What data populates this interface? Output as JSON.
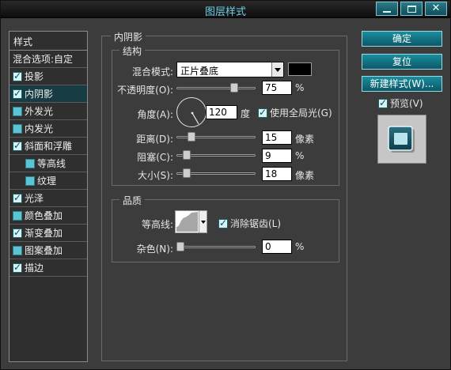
{
  "window": {
    "title": "图层样式"
  },
  "style_list": {
    "header": "样式",
    "items": [
      {
        "label": "混合选项:自定",
        "checkbox": "none"
      },
      {
        "label": "投影",
        "checkbox": "checked"
      },
      {
        "label": "内阴影",
        "checkbox": "checked",
        "active": true
      },
      {
        "label": "外发光",
        "checkbox": "unchecked"
      },
      {
        "label": "内发光",
        "checkbox": "unchecked"
      },
      {
        "label": "斜面和浮雕",
        "checkbox": "checked"
      },
      {
        "label": "等高线",
        "checkbox": "unchecked"
      },
      {
        "label": "纹理",
        "checkbox": "unchecked"
      },
      {
        "label": "光泽",
        "checkbox": "checked"
      },
      {
        "label": "颜色叠加",
        "checkbox": "unchecked"
      },
      {
        "label": "渐变叠加",
        "checkbox": "checked"
      },
      {
        "label": "图案叠加",
        "checkbox": "unchecked"
      },
      {
        "label": "描边",
        "checkbox": "checked"
      }
    ]
  },
  "inner_shadow": {
    "section_title": "内阴影",
    "structure": {
      "title": "结构",
      "blend_mode_label": "混合模式:",
      "blend_mode_value": "正片叠底",
      "blend_color": "#000000",
      "opacity_label": "不透明度(O):",
      "opacity_value": "75",
      "opacity_unit": "%",
      "opacity_fraction": 0.75,
      "angle_label": "角度(A):",
      "angle_value": "120",
      "angle_unit": "度",
      "global_light_label": "使用全局光(G)",
      "global_light_checked": true,
      "distance_label": "距离(D):",
      "distance_value": "15",
      "distance_unit": "像素",
      "choke_label": "阻塞(C):",
      "choke_value": "9",
      "choke_unit": "%",
      "size_label": "大小(S):",
      "size_value": "18",
      "size_unit": "像素"
    },
    "quality": {
      "title": "品质",
      "contour_label": "等高线:",
      "antialias_label": "消除锯齿(L)",
      "antialias_checked": true,
      "noise_label": "杂色(N):",
      "noise_value": "0",
      "noise_unit": "%"
    }
  },
  "buttons": {
    "ok": "确定",
    "reset": "复位",
    "new_style": "新建样式(W)...",
    "preview_label": "预览(V)",
    "preview_checked": true
  },
  "colors": {
    "accent": "#0b5766",
    "title_text": "#6fd0e6",
    "active_item": "#173c44"
  }
}
